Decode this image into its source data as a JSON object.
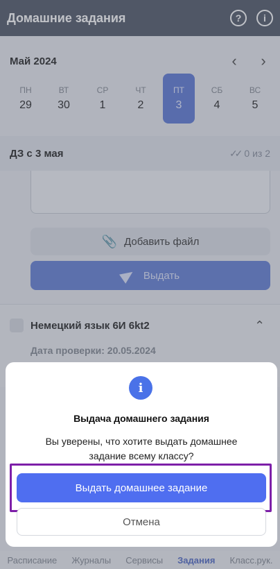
{
  "header": {
    "title": "Домашние задания",
    "help_icon": "?",
    "info_icon": "i"
  },
  "calendar": {
    "month": "Май 2024",
    "days": [
      {
        "dow": "ПН",
        "num": "29"
      },
      {
        "dow": "ВТ",
        "num": "30"
      },
      {
        "dow": "СР",
        "num": "1"
      },
      {
        "dow": "ЧТ",
        "num": "2"
      },
      {
        "dow": "ПТ",
        "num": "3",
        "active": true
      },
      {
        "dow": "СБ",
        "num": "4"
      },
      {
        "dow": "ВС",
        "num": "5"
      }
    ]
  },
  "homework": {
    "title": "ДЗ с 3 мая",
    "count": "0 из 2",
    "add_file_label": "Добавить файл",
    "issue_label": "Выдать"
  },
  "subject": {
    "name": "Немецкий язык 6И 6kt2",
    "check_date": "Дата проверки: 20.05.2024"
  },
  "dialog": {
    "icon": "i",
    "title": "Выдача домашнего задания",
    "message": "Вы уверены, что хотите выдать домашнее задание всему классу?",
    "confirm_label": "Выдать домашнее задание",
    "cancel_label": "Отмена"
  },
  "tabbar": {
    "items": [
      "Расписание",
      "Журналы",
      "Сервисы",
      "Задания",
      "Класс.рук."
    ],
    "active_index": 3
  },
  "colors": {
    "accent": "#4f6ef0",
    "highlight_border": "#7d1fa8",
    "header_bg": "#5b6271"
  }
}
